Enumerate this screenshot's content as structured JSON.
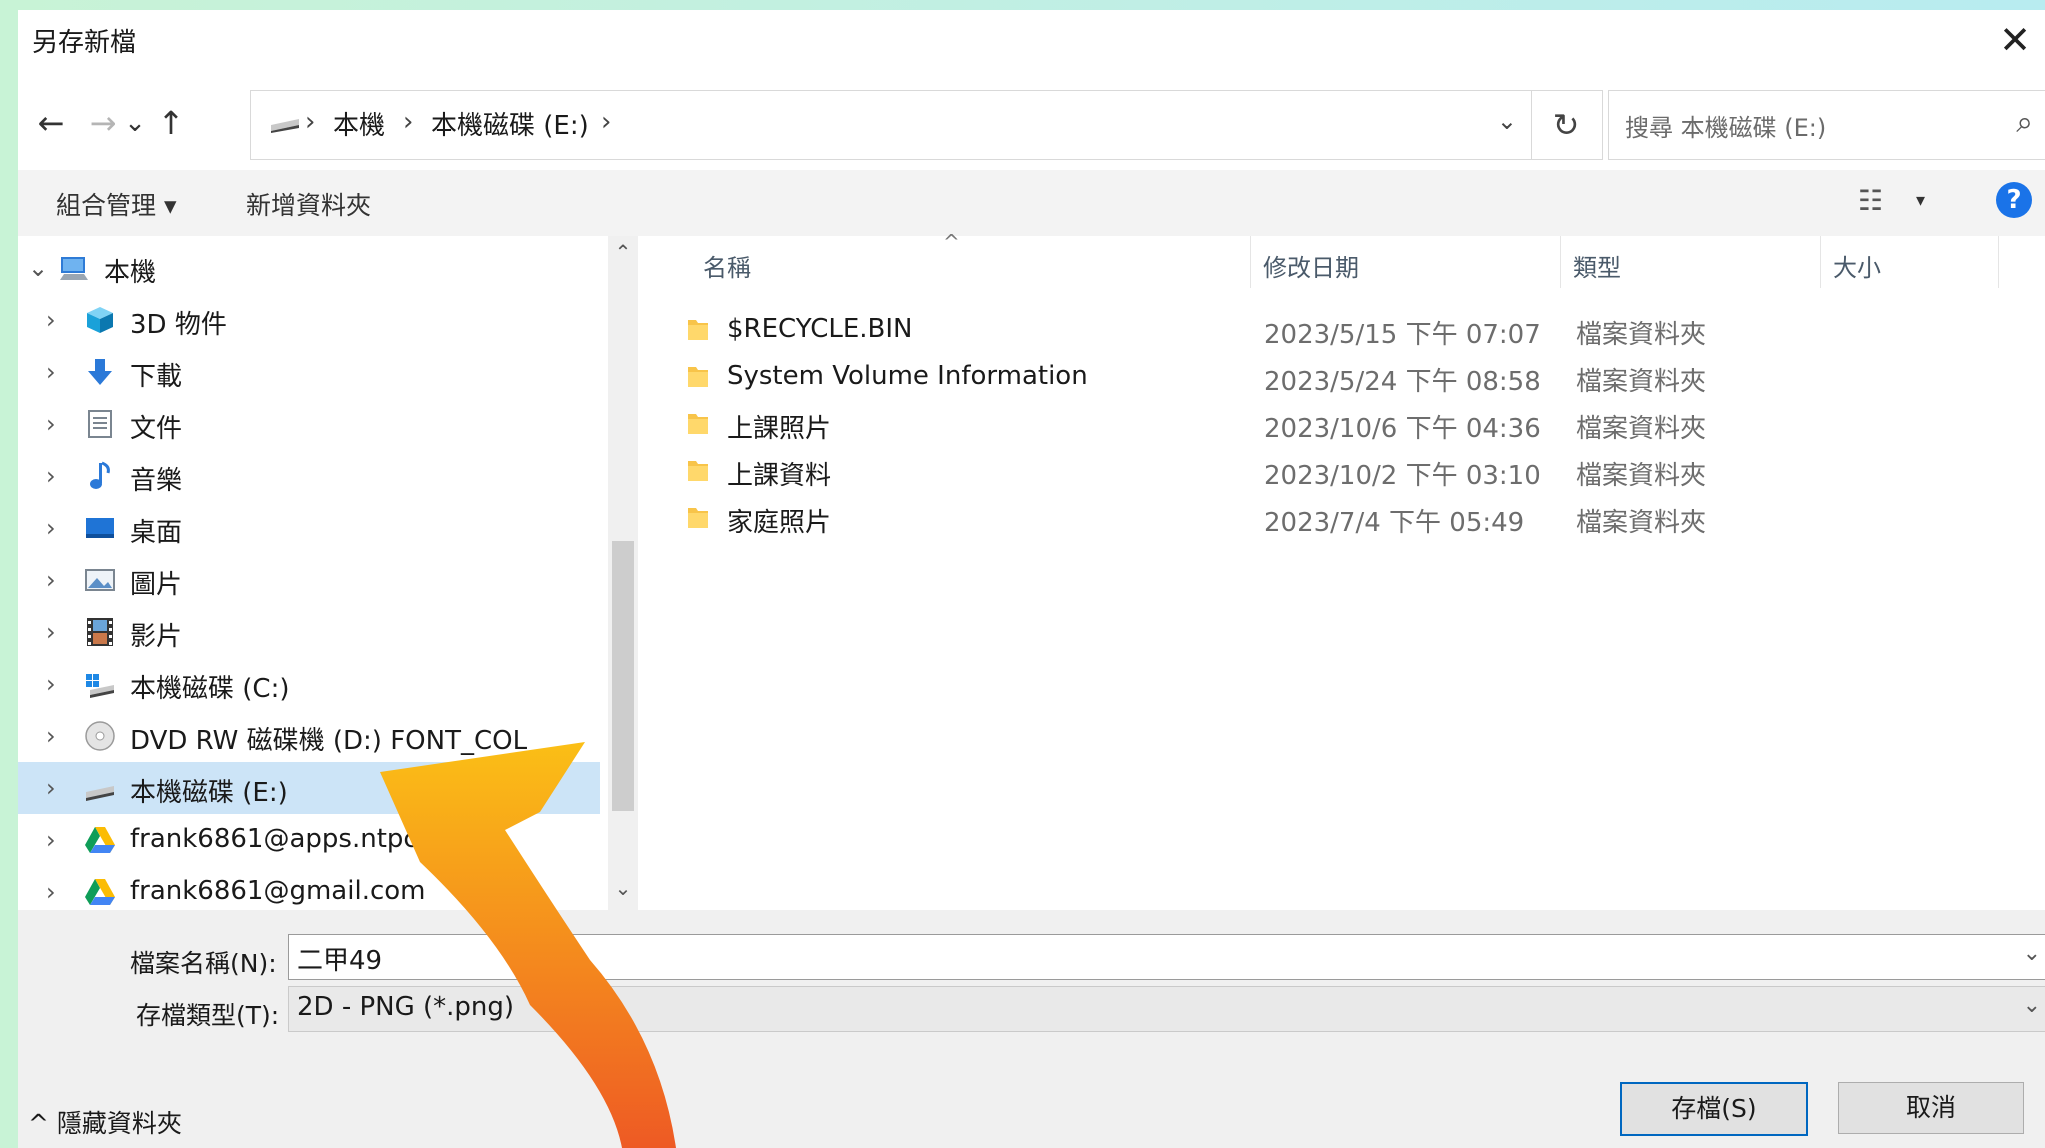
{
  "dialog": {
    "title": "另存新檔",
    "close": "✕"
  },
  "nav": {
    "back": "←",
    "forward": "→",
    "recent": "⌄",
    "up": "↑",
    "breadcrumb": [
      "本機",
      "本機磁碟 (E:)"
    ],
    "sep": "›",
    "dropdown": "⌄",
    "refresh": "↻",
    "search_placeholder": "搜尋 本機磁碟 (E:)",
    "search_icon": "⌕"
  },
  "toolbar": {
    "organize": "組合管理 ▾",
    "new_folder": "新增資料夾",
    "view_icon": "☷",
    "view_dropdown": "▾",
    "help": "?"
  },
  "tree": {
    "expand": "›",
    "collapse": "⌄",
    "items": [
      {
        "label": "本機",
        "icon": "computer-icon"
      },
      {
        "label": "3D 物件",
        "icon": "cube-icon"
      },
      {
        "label": "下載",
        "icon": "download-arrow-icon"
      },
      {
        "label": "文件",
        "icon": "document-icon"
      },
      {
        "label": "音樂",
        "icon": "music-note-icon"
      },
      {
        "label": "桌面",
        "icon": "desktop-icon"
      },
      {
        "label": "圖片",
        "icon": "picture-icon"
      },
      {
        "label": "影片",
        "icon": "film-icon"
      },
      {
        "label": "本機磁碟 (C:)",
        "icon": "windows-drive-icon"
      },
      {
        "label": "DVD RW 磁碟機 (D:) FONT_COL",
        "icon": "dvd-icon"
      },
      {
        "label": "本機磁碟 (E:)",
        "icon": "drive-icon"
      },
      {
        "label": "frank6861@apps.ntpc.",
        "icon": "google-drive-icon"
      },
      {
        "label": "frank6861@gmail.com",
        "icon": "google-drive-icon"
      }
    ]
  },
  "filelist": {
    "columns": [
      "名稱",
      "修改日期",
      "類型",
      "大小"
    ],
    "sort_caret": "^",
    "rows": [
      {
        "name": "$RECYCLE.BIN",
        "date": "2023/5/15 下午 07:07",
        "type": "檔案資料夾"
      },
      {
        "name": "System Volume Information",
        "date": "2023/5/24 下午 08:58",
        "type": "檔案資料夾"
      },
      {
        "name": "上課照片",
        "date": "2023/10/6 下午 04:36",
        "type": "檔案資料夾"
      },
      {
        "name": "上課資料",
        "date": "2023/10/2 下午 03:10",
        "type": "檔案資料夾"
      },
      {
        "name": "家庭照片",
        "date": "2023/7/4 下午 05:49",
        "type": "檔案資料夾"
      }
    ]
  },
  "footer": {
    "filename_label": "檔案名稱(N):",
    "filename_value": "二甲49",
    "filetype_label": "存檔類型(T):",
    "filetype_value": "2D - PNG (*.png)",
    "dropdown": "⌄",
    "hide_folders": "^ 隱藏資料夾",
    "save": "存檔(S)",
    "cancel": "取消"
  },
  "colors": {
    "accent": "#0067c0",
    "selection": "#cce4f7",
    "folder": "#f8c449",
    "arrow_top": "#fbbf16",
    "arrow_bottom": "#ee5a24"
  }
}
